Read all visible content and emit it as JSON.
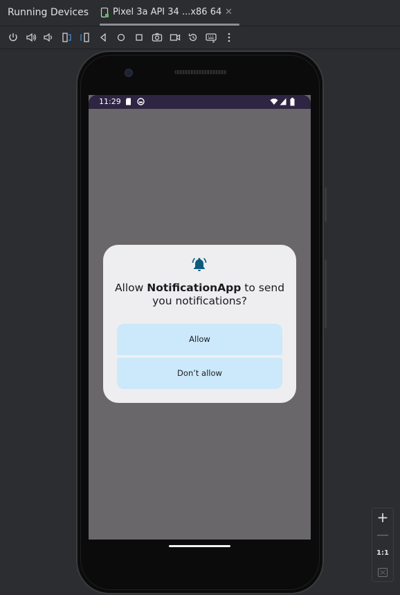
{
  "tool_window": {
    "title": "Running Devices"
  },
  "tab": {
    "label": "Pixel 3a API 34 ...x86 64",
    "close_glyph": "✕"
  },
  "toolbar": {
    "buttons": [
      "power-icon",
      "volume-up-icon",
      "volume-down-icon",
      "rotate-left-icon",
      "rotate-right-icon",
      "back-icon",
      "home-icon",
      "overview-icon",
      "screenshot-icon",
      "screen-record-icon",
      "snapshot-reset-icon",
      "keyboard-icon",
      "more-icon"
    ]
  },
  "device": {
    "status_bar": {
      "time": "11:29",
      "background": "#2d2541"
    },
    "dialog": {
      "text_before": "Allow ",
      "app_name": "NotificationApp",
      "text_after": " to send you notifications?",
      "allow_label": "Allow",
      "deny_label": "Don’t allow",
      "button_color": "#cce8fb",
      "bell_color": "#0a5b7d"
    }
  },
  "zoom_controls": {
    "plus": "+",
    "minus": "—",
    "actual_size": "1:1"
  }
}
